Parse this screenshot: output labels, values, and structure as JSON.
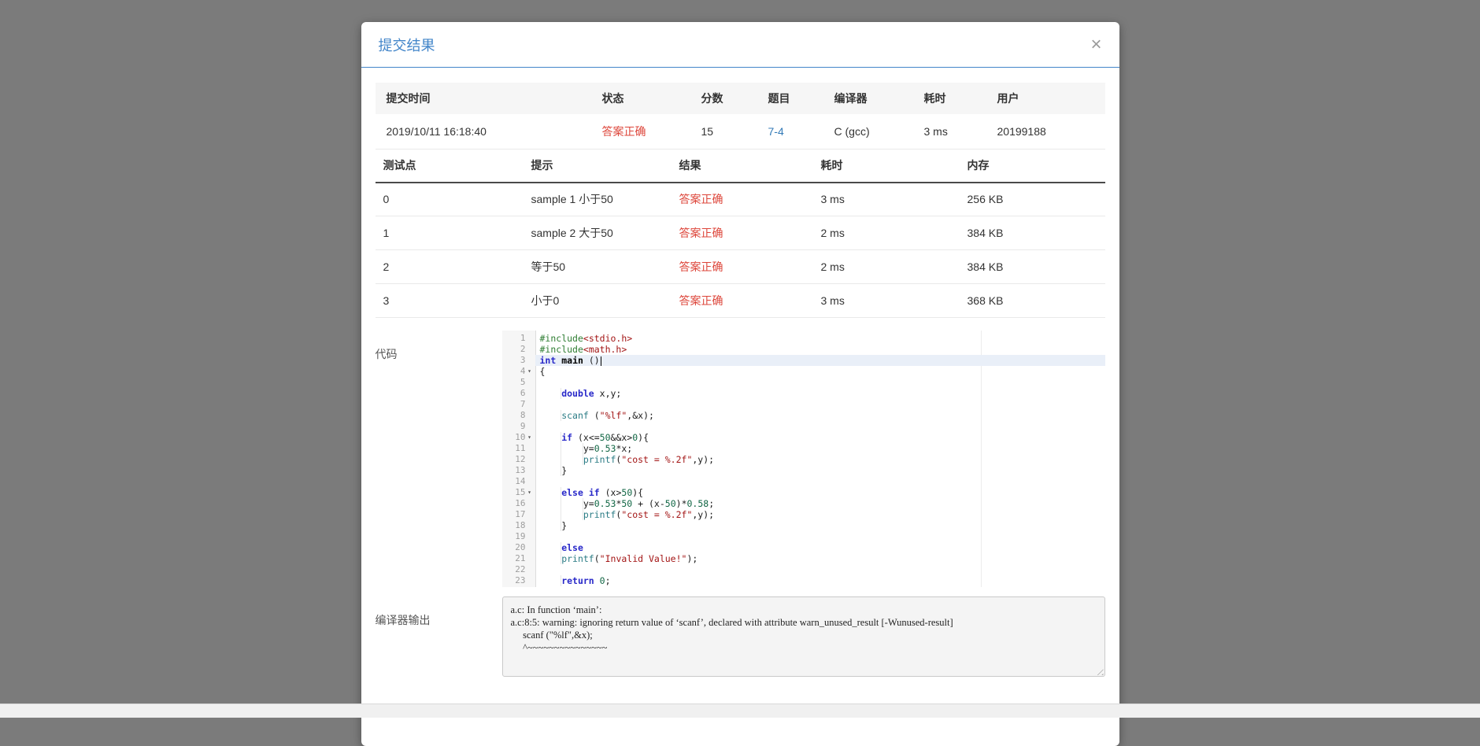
{
  "modal": {
    "title": "提交结果",
    "close_label": "×"
  },
  "submission_table": {
    "headers": [
      "提交时间",
      "状态",
      "分数",
      "题目",
      "编译器",
      "耗时",
      "用户"
    ],
    "row": {
      "time": "2019/10/11 16:18:40",
      "status": "答案正确",
      "score": "15",
      "problem": "7-4",
      "compiler": "C (gcc)",
      "duration": "3 ms",
      "user": "20199188"
    }
  },
  "testcase_table": {
    "headers": [
      "测试点",
      "提示",
      "结果",
      "耗时",
      "内存"
    ],
    "rows": [
      {
        "id": "0",
        "hint": "sample 1 小于50",
        "result": "答案正确",
        "duration": "3 ms",
        "memory": "256 KB"
      },
      {
        "id": "1",
        "hint": "sample 2 大于50",
        "result": "答案正确",
        "duration": "2 ms",
        "memory": "384 KB"
      },
      {
        "id": "2",
        "hint": "等于50",
        "result": "答案正确",
        "duration": "2 ms",
        "memory": "384 KB"
      },
      {
        "id": "3",
        "hint": "小于0",
        "result": "答案正确",
        "duration": "3 ms",
        "memory": "368 KB"
      }
    ]
  },
  "code_section": {
    "label": "代码",
    "lines": [
      {
        "n": 1,
        "tokens": [
          [
            "meta",
            "#include"
          ],
          [
            "incl",
            "<stdio.h>"
          ]
        ]
      },
      {
        "n": 2,
        "tokens": [
          [
            "meta",
            "#include"
          ],
          [
            "incl",
            "<math.h>"
          ]
        ]
      },
      {
        "n": 3,
        "active": true,
        "cursor": true,
        "tokens": [
          [
            "kw",
            "int"
          ],
          [
            "plain",
            " "
          ],
          [
            "fn",
            "main"
          ],
          [
            "plain",
            " ()"
          ]
        ]
      },
      {
        "n": 4,
        "fold": true,
        "tokens": [
          [
            "plain",
            "{"
          ]
        ]
      },
      {
        "n": 5,
        "tokens": []
      },
      {
        "n": 6,
        "tokens": [
          [
            "plain",
            "    "
          ],
          [
            "kw",
            "double"
          ],
          [
            "plain",
            " x,y;"
          ]
        ]
      },
      {
        "n": 7,
        "tokens": []
      },
      {
        "n": 8,
        "tokens": [
          [
            "plain",
            "    "
          ],
          [
            "builtin",
            "scanf"
          ],
          [
            "plain",
            " ("
          ],
          [
            "str",
            "\"%lf\""
          ],
          [
            "plain",
            ",&x);"
          ]
        ]
      },
      {
        "n": 9,
        "tokens": []
      },
      {
        "n": 10,
        "fold": true,
        "tokens": [
          [
            "plain",
            "    "
          ],
          [
            "kw",
            "if"
          ],
          [
            "plain",
            " (x<="
          ],
          [
            "num",
            "50"
          ],
          [
            "plain",
            "&&x>"
          ],
          [
            "num",
            "0"
          ],
          [
            "plain",
            "){"
          ]
        ]
      },
      {
        "n": 11,
        "tokens": [
          [
            "plain",
            "        y="
          ],
          [
            "num",
            "0.53"
          ],
          [
            "plain",
            "*x;"
          ]
        ]
      },
      {
        "n": 12,
        "tokens": [
          [
            "plain",
            "        "
          ],
          [
            "builtin",
            "printf"
          ],
          [
            "plain",
            "("
          ],
          [
            "str",
            "\"cost = %.2f\""
          ],
          [
            "plain",
            ",y);"
          ]
        ]
      },
      {
        "n": 13,
        "tokens": [
          [
            "plain",
            "    }"
          ]
        ]
      },
      {
        "n": 14,
        "tokens": []
      },
      {
        "n": 15,
        "fold": true,
        "tokens": [
          [
            "plain",
            "    "
          ],
          [
            "kw",
            "else"
          ],
          [
            "plain",
            " "
          ],
          [
            "kw",
            "if"
          ],
          [
            "plain",
            " (x>"
          ],
          [
            "num",
            "50"
          ],
          [
            "plain",
            "){"
          ]
        ]
      },
      {
        "n": 16,
        "tokens": [
          [
            "plain",
            "        y="
          ],
          [
            "num",
            "0.53"
          ],
          [
            "plain",
            "*"
          ],
          [
            "num",
            "50"
          ],
          [
            "plain",
            " + (x-"
          ],
          [
            "num",
            "50"
          ],
          [
            "plain",
            ")*"
          ],
          [
            "num",
            "0.58"
          ],
          [
            "plain",
            ";"
          ]
        ]
      },
      {
        "n": 17,
        "tokens": [
          [
            "plain",
            "        "
          ],
          [
            "builtin",
            "printf"
          ],
          [
            "plain",
            "("
          ],
          [
            "str",
            "\"cost = %.2f\""
          ],
          [
            "plain",
            ",y);"
          ]
        ]
      },
      {
        "n": 18,
        "tokens": [
          [
            "plain",
            "    }"
          ]
        ]
      },
      {
        "n": 19,
        "tokens": []
      },
      {
        "n": 20,
        "tokens": [
          [
            "plain",
            "    "
          ],
          [
            "kw",
            "else"
          ]
        ]
      },
      {
        "n": 21,
        "tokens": [
          [
            "plain",
            "    "
          ],
          [
            "builtin",
            "printf"
          ],
          [
            "plain",
            "("
          ],
          [
            "str",
            "\"Invalid Value!\""
          ],
          [
            "plain",
            ");"
          ]
        ]
      },
      {
        "n": 22,
        "tokens": []
      },
      {
        "n": 23,
        "tokens": [
          [
            "plain",
            "    "
          ],
          [
            "kw",
            "return"
          ],
          [
            "plain",
            " "
          ],
          [
            "num",
            "0"
          ],
          [
            "plain",
            ";"
          ]
        ]
      }
    ]
  },
  "compiler_section": {
    "label": "编译器输出",
    "output": "a.c: In function ‘main’:\na.c:8:5: warning: ignoring return value of ‘scanf’, declared with attribute warn_unused_result [-Wunused-result]\n     scanf (\"%lf\",&x);\n     ^~~~~~~~~~~~~~~~"
  },
  "colors": {
    "accent_blue": "#4285c9",
    "status_red": "#dd453a",
    "link_blue": "#337ab7"
  }
}
